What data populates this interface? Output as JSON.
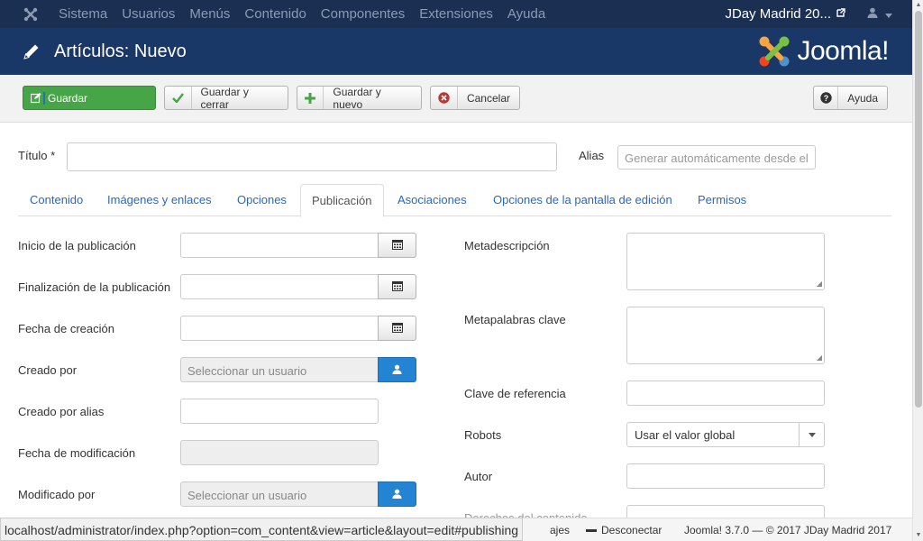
{
  "navbar": {
    "menu": [
      "Sistema",
      "Usuarios",
      "Menús",
      "Contenido",
      "Componentes",
      "Extensiones",
      "Ayuda"
    ],
    "site_name": "JDay Madrid 20...",
    "user_icon": "user-icon"
  },
  "header": {
    "title": "Artículos: Nuevo",
    "logo_text": "Joomla!"
  },
  "toolbar": {
    "save": "Guardar",
    "save_close": "Guardar y cerrar",
    "save_new": "Guardar y nuevo",
    "cancel": "Cancelar",
    "help": "Ayuda"
  },
  "form": {
    "title_label": "Título *",
    "title_value": "",
    "alias_label": "Alias",
    "alias_placeholder": "Generar automáticamente desde el"
  },
  "tabs": [
    "Contenido",
    "Imágenes y enlaces",
    "Opciones",
    "Publicación",
    "Asociaciones",
    "Opciones de la pantalla de edición",
    "Permisos"
  ],
  "active_tab": "Publicación",
  "publishing": {
    "publish_up": "Inicio de la publicación",
    "publish_down": "Finalización de la publicación",
    "created": "Fecha de creación",
    "created_by": "Creado por",
    "created_by_placeholder": "Seleccionar un usuario",
    "created_by_alias": "Creado por alias",
    "modified": "Fecha de modificación",
    "modified_by": "Modificado por",
    "modified_by_placeholder": "Seleccionar un usuario"
  },
  "metadata": {
    "metadesc": "Metadescripción",
    "metakey": "Metapalabras clave",
    "xreference": "Clave de referencia",
    "robots": "Robots",
    "robots_value": "Usar el valor global",
    "author": "Autor",
    "rights_partial": "Derechos del contenido"
  },
  "footer": {
    "preview_partial": "ajes",
    "logout": "Desconectar",
    "version": "Joomla! 3.7.0",
    "copyright": "— © 2017 JDay Madrid 2017"
  },
  "status_url": "localhost/administrator/index.php?option=com_content&view=article&layout=edit#publishing"
}
